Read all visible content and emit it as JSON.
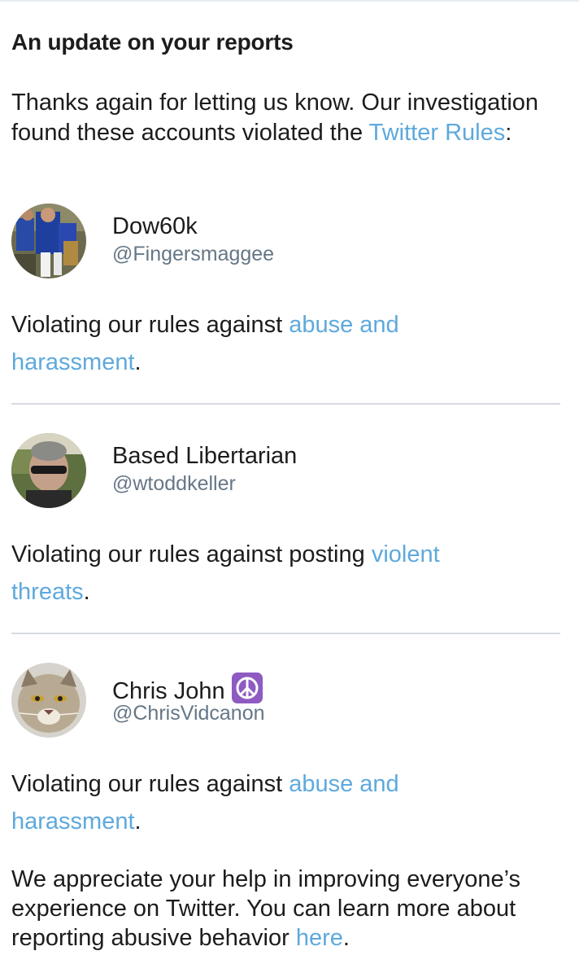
{
  "header": {
    "title": "An update on your reports"
  },
  "intro": {
    "text": "Thanks again for letting us know. Our investigation found these accounts violated the ",
    "link": "Twitter Rules",
    "suffix": ":"
  },
  "accounts": [
    {
      "display_name": "Dow60k",
      "handle": "@Fingersmaggee",
      "reason_prefix": "Violating our rules against ",
      "reason_link": "abuse and harassment",
      "reason_suffix": "."
    },
    {
      "display_name": "Based Libertarian",
      "handle": "@wtoddkeller",
      "reason_prefix": "Violating our rules against posting ",
      "reason_link": "violent threats",
      "reason_suffix": "."
    },
    {
      "display_name": "Chris John",
      "badge_icon": "peace-symbol-icon",
      "handle": "@ChrisVidcanon",
      "reason_prefix": "Violating our rules against ",
      "reason_link": "abuse and harassment",
      "reason_suffix": "."
    }
  ],
  "closing": {
    "text": "We appreciate your help in improving everyone’s experience on Twitter. You can learn more about reporting abusive behavior ",
    "link": "here",
    "suffix": "."
  },
  "colors": {
    "link": "#5ea9dd",
    "text": "#1c1c1c",
    "handle": "#657786",
    "divider": "#d7dbdf",
    "badge": "#8e5bc2"
  }
}
